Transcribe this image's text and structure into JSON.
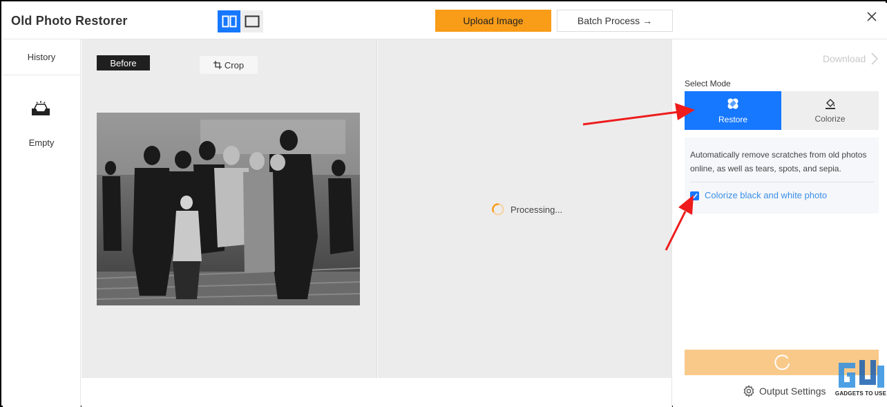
{
  "header": {
    "title": "Old Photo Restorer",
    "upload_label": "Upload Image",
    "batch_label": "Batch Process →",
    "view_modes": [
      "split-view-icon",
      "single-view-icon"
    ]
  },
  "sidebar": {
    "history_label": "History",
    "empty_label": "Empty"
  },
  "before_panel": {
    "tag": "Before",
    "crop_label": "Crop"
  },
  "after_panel": {
    "status": "Processing..."
  },
  "right_panel": {
    "download_label": "Download",
    "select_mode_label": "Select Mode",
    "modes": [
      {
        "label": "Restore",
        "icon": "bandage-icon",
        "active": true
      },
      {
        "label": "Colorize",
        "icon": "paint-bucket-icon",
        "active": false
      }
    ],
    "description": "Automatically remove scratches from old photos online, as well as tears, spots, and sepia.",
    "colorize_checkbox_label": "Colorize black and white photo",
    "colorize_checked": true,
    "output_settings_label": "Output Settings"
  },
  "watermark": {
    "text": "GADGETS TO USE"
  },
  "colors": {
    "accent": "#1677ff",
    "upload": "#f99c18",
    "start_button": "#f9c98a",
    "annotation_arrow": "#ee1c1c"
  }
}
